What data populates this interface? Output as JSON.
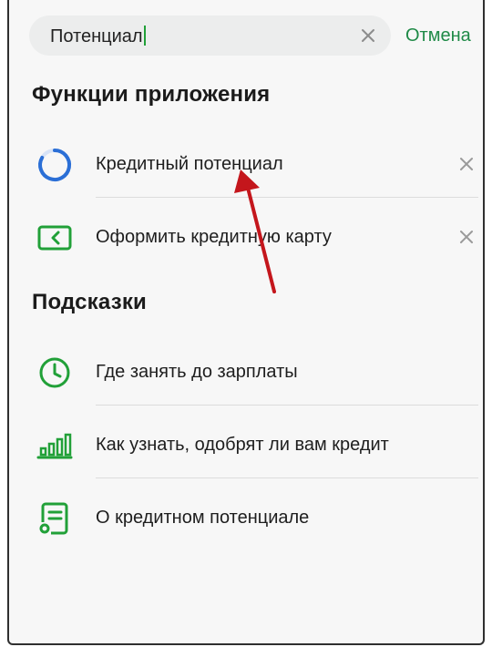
{
  "search": {
    "value": "Потенциал",
    "cancel_label": "Отмена"
  },
  "sections": {
    "functions_title": "Функции приложения",
    "hints_title": "Подсказки"
  },
  "functions": [
    {
      "label": "Кредитный потенциал",
      "icon": "credit-potential-ring-icon"
    },
    {
      "label": "Оформить кредитную карту",
      "icon": "credit-card-icon"
    }
  ],
  "hints": [
    {
      "label": "Где занять до зарплаты",
      "icon": "clock-icon"
    },
    {
      "label": "Как узнать, одобрят ли вам кредит",
      "icon": "bar-chart-icon"
    },
    {
      "label": "О кредитном потенциале",
      "icon": "document-icon"
    }
  ],
  "colors": {
    "accent_green": "#21a038",
    "link_green": "#1f8a47",
    "ring_blue": "#2b6fd6",
    "annotation_red": "#c4161c"
  }
}
